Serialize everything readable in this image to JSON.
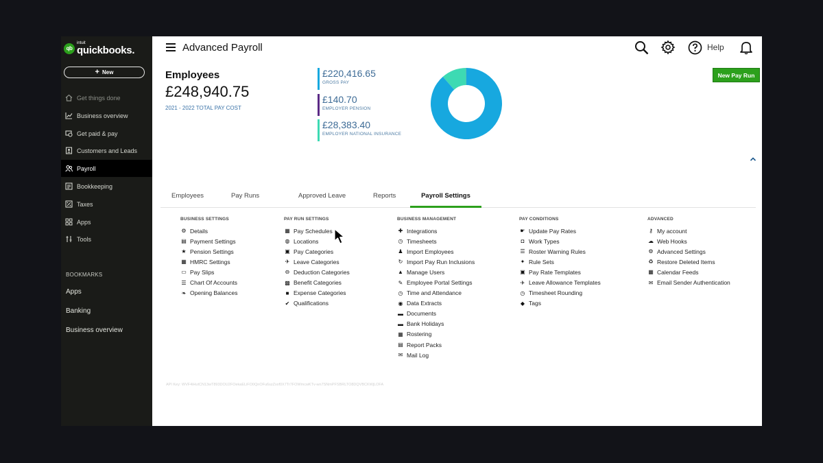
{
  "sidebar": {
    "logo_intuit": "intuit",
    "logo_text": "quickbooks.",
    "new_label": "New",
    "items": [
      {
        "label": "Get things done",
        "icon": "home-icon"
      },
      {
        "label": "Business overview",
        "icon": "chart-icon"
      },
      {
        "label": "Get paid & pay",
        "icon": "payments-icon"
      },
      {
        "label": "Customers and Leads",
        "icon": "customers-icon"
      },
      {
        "label": "Payroll",
        "icon": "people-icon"
      },
      {
        "label": "Bookkeeping",
        "icon": "ledger-icon"
      },
      {
        "label": "Taxes",
        "icon": "taxes-icon"
      },
      {
        "label": "Apps",
        "icon": "apps-icon"
      },
      {
        "label": "Tools",
        "icon": "tools-icon"
      }
    ],
    "bookmarks_title": "BOOKMARKS",
    "bookmarks": [
      "Apps",
      "Banking",
      "Business overview"
    ]
  },
  "header": {
    "title": "Advanced Payroll",
    "help_label": "Help"
  },
  "summary": {
    "title": "Employees",
    "total": "£248,940.75",
    "subtitle": "2021 - 2022 TOTAL PAY COST",
    "stats": [
      {
        "value": "£220,416.65",
        "label": "GROSS PAY",
        "color": "#17a8df"
      },
      {
        "value": "£140.70",
        "label": "EMPLOYER PENSION",
        "color": "#5b2a86"
      },
      {
        "value": "£28,383.40",
        "label": "EMPLOYER NATIONAL INSURANCE",
        "color": "#3ddab3"
      }
    ],
    "new_pay_run": "New Pay Run"
  },
  "chart_data": {
    "type": "pie",
    "labels": [
      "Gross pay",
      "Employer pension",
      "Employer national insurance"
    ],
    "values": [
      220416.65,
      140.7,
      28383.4
    ],
    "colors": [
      "#17a8df",
      "#5b2a86",
      "#3ddab3"
    ]
  },
  "tabs": [
    "Employees",
    "Pay Runs",
    "Approved Leave",
    "Reports",
    "Payroll Settings"
  ],
  "settings": [
    {
      "title": "BUSINESS SETTINGS",
      "items": [
        {
          "label": "Details",
          "icon": "gear-icon"
        },
        {
          "label": "Payment Settings",
          "icon": "document-icon"
        },
        {
          "label": "Pension Settings",
          "icon": "star-icon"
        },
        {
          "label": "HMRC Settings",
          "icon": "building-icon"
        },
        {
          "label": "Pay Slips",
          "icon": "payslip-icon"
        },
        {
          "label": "Chart Of Accounts",
          "icon": "list-icon"
        },
        {
          "label": "Opening Balances",
          "icon": "leaf-icon"
        }
      ]
    },
    {
      "title": "PAY RUN SETTINGS",
      "items": [
        {
          "label": "Pay Schedules",
          "icon": "calendar-icon"
        },
        {
          "label": "Locations",
          "icon": "globe-icon"
        },
        {
          "label": "Pay Categories",
          "icon": "money-icon"
        },
        {
          "label": "Leave Categories",
          "icon": "plane-icon"
        },
        {
          "label": "Deduction Categories",
          "icon": "minus-circle-icon"
        },
        {
          "label": "Benefit Categories",
          "icon": "gift-icon"
        },
        {
          "label": "Expense Categories",
          "icon": "square-icon"
        },
        {
          "label": "Qualifications",
          "icon": "check-icon"
        }
      ]
    },
    {
      "title": "BUSINESS MANAGEMENT",
      "items": [
        {
          "label": "Integrations",
          "icon": "puzzle-icon"
        },
        {
          "label": "Timesheets",
          "icon": "clock-icon"
        },
        {
          "label": "Import Employees",
          "icon": "people-icon"
        },
        {
          "label": "Import Pay Run Inclusions",
          "icon": "refresh-icon"
        },
        {
          "label": "Manage Users",
          "icon": "lock-icon"
        },
        {
          "label": "Employee Portal Settings",
          "icon": "brush-icon"
        },
        {
          "label": "Time and Attendance",
          "icon": "clock-icon"
        },
        {
          "label": "Data Extracts",
          "icon": "database-icon"
        },
        {
          "label": "Documents",
          "icon": "folder-icon"
        },
        {
          "label": "Bank Holidays",
          "icon": "folder-icon"
        },
        {
          "label": "Rostering",
          "icon": "calendar-icon"
        },
        {
          "label": "Report Packs",
          "icon": "document-icon"
        },
        {
          "label": "Mail Log",
          "icon": "envelope-icon"
        }
      ]
    },
    {
      "title": "PAY CONDITIONS",
      "items": [
        {
          "label": "Update Pay Rates",
          "icon": "hand-money-icon"
        },
        {
          "label": "Work Types",
          "icon": "camera-icon"
        },
        {
          "label": "Roster Warning Rules",
          "icon": "list-icon"
        },
        {
          "label": "Rule Sets",
          "icon": "wand-icon"
        },
        {
          "label": "Pay Rate Templates",
          "icon": "money-icon"
        },
        {
          "label": "Leave Allowance Templates",
          "icon": "plane-icon"
        },
        {
          "label": "Timesheet Rounding",
          "icon": "clock-icon"
        },
        {
          "label": "Tags",
          "icon": "tag-icon"
        }
      ]
    },
    {
      "title": "ADVANCED",
      "items": [
        {
          "label": "My account",
          "icon": "key-icon"
        },
        {
          "label": "Web Hooks",
          "icon": "cloud-icon"
        },
        {
          "label": "Advanced Settings",
          "icon": "gear-icon"
        },
        {
          "label": "Restore Deleted Items",
          "icon": "recycle-icon"
        },
        {
          "label": "Calendar Feeds",
          "icon": "calendar-icon"
        },
        {
          "label": "Email Sender Authentication",
          "icon": "envelope-icon"
        }
      ]
    }
  ],
  "api_key": "API Key: WVF4iHutCN13wT893DOU2FOekaELiFO0QnOFu6szZxxf0X7Tr7FOWmcwKTv-wn7SNmPFSBRLTO8DQVBCKWjLOFA"
}
